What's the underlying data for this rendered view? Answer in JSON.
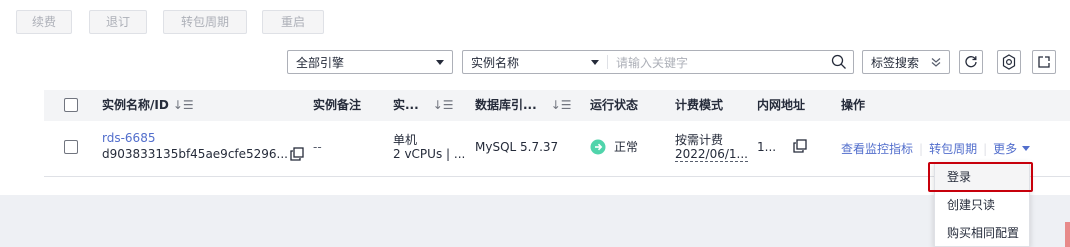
{
  "toolbar": {
    "renew_label": "续费",
    "unsubscribe_label": "退订",
    "change_billing_label": "转包周期",
    "restart_label": "重启"
  },
  "filters": {
    "engine_select": "全部引擎",
    "field_select": "实例名称",
    "keyword_placeholder": "请输入关键字",
    "tag_search_label": "标签搜索"
  },
  "table": {
    "headers": {
      "name_id": "实例名称/ID",
      "remark": "实例备注",
      "type": "实...",
      "engine": "数据库引...",
      "status": "运行状态",
      "billing": "计费模式",
      "private_ip": "内网地址",
      "operation": "操作"
    },
    "rows": [
      {
        "name": "rds-6685",
        "id": "d903833135bf45ae9cfe5296...",
        "remark": "--",
        "type_line1": "单机",
        "type_line2": "2 vCPUs | ...",
        "engine": "MySQL 5.7.37",
        "status": "正常",
        "billing_line1": "按需计费",
        "billing_line2": "2022/06/1...",
        "private_ip": "1...",
        "actions": {
          "monitor": "查看监控指标",
          "change_billing": "转包周期",
          "more": "更多"
        }
      }
    ]
  },
  "more_menu": {
    "items": [
      "登录",
      "创建只读",
      "购买相同配置"
    ]
  },
  "colors": {
    "link": "#526ecc",
    "status_ok": "#50d4ab",
    "highlight_border": "#c7000b"
  }
}
